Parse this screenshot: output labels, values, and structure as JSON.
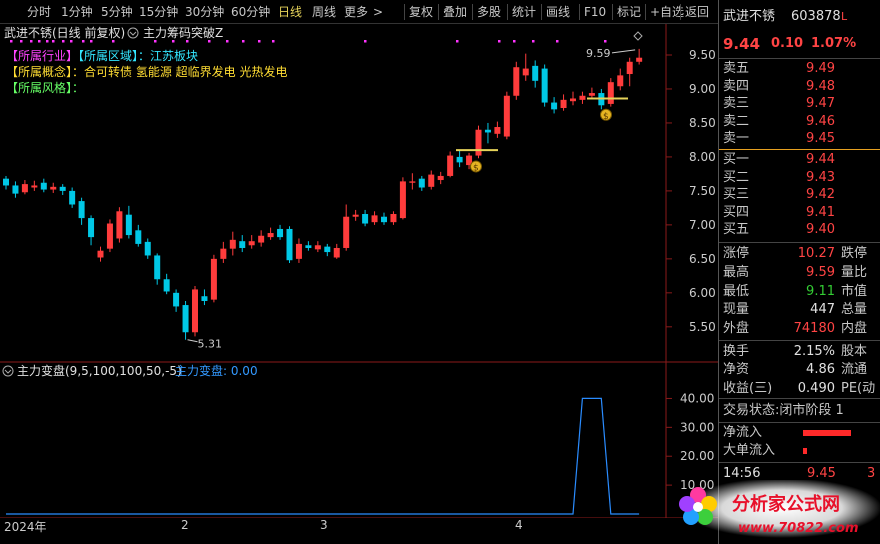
{
  "toolbar": {
    "items": [
      "分时",
      "1分钟",
      "5分钟",
      "15分钟",
      "30分钟",
      "60分钟",
      "日线",
      "周线",
      "更多"
    ],
    "active_index": 6,
    "tools": [
      "复权",
      "叠加",
      "多股",
      "统计",
      "画线",
      "F10",
      "标记",
      "+自选",
      "返回"
    ]
  },
  "main_chart": {
    "title": "武进不锈(日线 前复权)",
    "indicator_name": "主力筹码突破Z",
    "info_lines": [
      {
        "tag1": "【所属行业】",
        "tag2": "【所属区域】",
        "text": "：江苏板块"
      },
      {
        "tag1": "【所属概念】",
        "text": "：合可转债 氢能源 超临界发电 光热发电"
      },
      {
        "tag1": "【所属风格】",
        "text": "："
      }
    ],
    "price_axis": [
      "9.50",
      "9.00",
      "8.50",
      "8.00",
      "7.50",
      "7.00",
      "6.50",
      "6.00",
      "5.50"
    ],
    "high_label": "9.59",
    "low_label": "5.31",
    "coin_icon_label": "$"
  },
  "sub_chart": {
    "title": "主力变盘(9,5,100,100,50,-5)",
    "value_label": "主力变盘: 0.00",
    "axis": [
      "40.00",
      "30.00",
      "20.00",
      "10.00"
    ]
  },
  "date_axis": [
    "2024年",
    "2",
    "3",
    "4"
  ],
  "chart_data": [
    {
      "type": "candlestick",
      "title": "",
      "ylim": [
        5.1,
        9.75
      ],
      "candles": [
        {
          "o": 7.68,
          "c": 7.58,
          "h": 7.72,
          "l": 7.52,
          "up": false
        },
        {
          "o": 7.58,
          "c": 7.46,
          "h": 7.64,
          "l": 7.4,
          "up": false
        },
        {
          "o": 7.48,
          "c": 7.6,
          "h": 7.66,
          "l": 7.45,
          "up": true
        },
        {
          "o": 7.58,
          "c": 7.55,
          "h": 7.65,
          "l": 7.5,
          "up": true
        },
        {
          "o": 7.62,
          "c": 7.52,
          "h": 7.68,
          "l": 7.48,
          "up": false
        },
        {
          "o": 7.52,
          "c": 7.56,
          "h": 7.62,
          "l": 7.47,
          "up": true
        },
        {
          "o": 7.56,
          "c": 7.5,
          "h": 7.6,
          "l": 7.44,
          "up": false
        },
        {
          "o": 7.5,
          "c": 7.3,
          "h": 7.55,
          "l": 7.25,
          "up": false
        },
        {
          "o": 7.35,
          "c": 7.1,
          "h": 7.4,
          "l": 7.0,
          "up": false
        },
        {
          "o": 7.1,
          "c": 6.82,
          "h": 7.14,
          "l": 6.7,
          "up": false
        },
        {
          "o": 6.52,
          "c": 6.62,
          "h": 6.68,
          "l": 6.46,
          "up": true
        },
        {
          "o": 6.65,
          "c": 7.02,
          "h": 7.08,
          "l": 6.6,
          "up": true
        },
        {
          "o": 6.8,
          "c": 7.2,
          "h": 7.26,
          "l": 6.74,
          "up": true
        },
        {
          "o": 7.15,
          "c": 6.85,
          "h": 7.28,
          "l": 6.8,
          "up": false
        },
        {
          "o": 6.92,
          "c": 6.72,
          "h": 7.0,
          "l": 6.68,
          "up": false
        },
        {
          "o": 6.75,
          "c": 6.55,
          "h": 6.8,
          "l": 6.5,
          "up": false
        },
        {
          "o": 6.55,
          "c": 6.2,
          "h": 6.58,
          "l": 6.12,
          "up": false
        },
        {
          "o": 6.2,
          "c": 6.02,
          "h": 6.28,
          "l": 5.98,
          "up": false
        },
        {
          "o": 6.0,
          "c": 5.8,
          "h": 6.05,
          "l": 5.72,
          "up": false
        },
        {
          "o": 5.82,
          "c": 5.42,
          "h": 5.88,
          "l": 5.31,
          "up": false
        },
        {
          "o": 5.42,
          "c": 6.05,
          "h": 6.1,
          "l": 5.36,
          "up": true
        },
        {
          "o": 5.95,
          "c": 5.88,
          "h": 6.05,
          "l": 5.82,
          "up": false
        },
        {
          "o": 5.9,
          "c": 6.5,
          "h": 6.56,
          "l": 5.86,
          "up": true
        },
        {
          "o": 6.5,
          "c": 6.65,
          "h": 6.75,
          "l": 6.44,
          "up": true
        },
        {
          "o": 6.65,
          "c": 6.78,
          "h": 6.9,
          "l": 6.55,
          "up": true
        },
        {
          "o": 6.76,
          "c": 6.66,
          "h": 6.85,
          "l": 6.6,
          "up": false
        },
        {
          "o": 6.7,
          "c": 6.76,
          "h": 6.85,
          "l": 6.65,
          "up": true
        },
        {
          "o": 6.74,
          "c": 6.84,
          "h": 6.92,
          "l": 6.68,
          "up": true
        },
        {
          "o": 6.82,
          "c": 6.88,
          "h": 6.96,
          "l": 6.78,
          "up": true
        },
        {
          "o": 6.94,
          "c": 6.82,
          "h": 7.0,
          "l": 6.78,
          "up": false
        },
        {
          "o": 6.94,
          "c": 6.48,
          "h": 6.98,
          "l": 6.44,
          "up": false
        },
        {
          "o": 6.5,
          "c": 6.72,
          "h": 6.8,
          "l": 6.44,
          "up": true
        },
        {
          "o": 6.7,
          "c": 6.66,
          "h": 6.76,
          "l": 6.62,
          "up": false
        },
        {
          "o": 6.64,
          "c": 6.7,
          "h": 6.76,
          "l": 6.6,
          "up": true
        },
        {
          "o": 6.68,
          "c": 6.6,
          "h": 6.72,
          "l": 6.54,
          "up": false
        },
        {
          "o": 6.52,
          "c": 6.66,
          "h": 6.72,
          "l": 6.5,
          "up": true
        },
        {
          "o": 6.66,
          "c": 7.12,
          "h": 7.3,
          "l": 6.62,
          "up": true
        },
        {
          "o": 7.12,
          "c": 7.15,
          "h": 7.22,
          "l": 7.06,
          "up": true
        },
        {
          "o": 7.16,
          "c": 7.02,
          "h": 7.22,
          "l": 6.98,
          "up": false
        },
        {
          "o": 7.04,
          "c": 7.14,
          "h": 7.2,
          "l": 7.0,
          "up": true
        },
        {
          "o": 7.12,
          "c": 7.04,
          "h": 7.18,
          "l": 7.0,
          "up": false
        },
        {
          "o": 7.04,
          "c": 7.16,
          "h": 7.2,
          "l": 7.0,
          "up": true
        },
        {
          "o": 7.1,
          "c": 7.64,
          "h": 7.7,
          "l": 7.08,
          "up": true
        },
        {
          "o": 7.64,
          "c": 7.62,
          "h": 7.76,
          "l": 7.52,
          "up": true
        },
        {
          "o": 7.68,
          "c": 7.55,
          "h": 7.72,
          "l": 7.5,
          "up": false
        },
        {
          "o": 7.56,
          "c": 7.74,
          "h": 7.8,
          "l": 7.52,
          "up": true
        },
        {
          "o": 7.66,
          "c": 7.72,
          "h": 7.78,
          "l": 7.6,
          "up": true
        },
        {
          "o": 7.72,
          "c": 8.02,
          "h": 8.08,
          "l": 7.7,
          "up": true
        },
        {
          "o": 8.0,
          "c": 7.92,
          "h": 8.1,
          "l": 7.85,
          "up": false
        },
        {
          "o": 7.88,
          "c": 8.02,
          "h": 8.06,
          "l": 7.82,
          "up": true
        },
        {
          "o": 8.02,
          "c": 8.4,
          "h": 8.46,
          "l": 7.98,
          "up": true
        },
        {
          "o": 8.4,
          "c": 8.36,
          "h": 8.5,
          "l": 8.2,
          "up": false
        },
        {
          "o": 8.34,
          "c": 8.44,
          "h": 8.52,
          "l": 8.28,
          "up": true
        },
        {
          "o": 8.3,
          "c": 8.9,
          "h": 8.96,
          "l": 8.26,
          "up": true
        },
        {
          "o": 8.9,
          "c": 9.32,
          "h": 9.4,
          "l": 8.84,
          "up": true
        },
        {
          "o": 9.3,
          "c": 9.2,
          "h": 9.52,
          "l": 9.12,
          "up": true
        },
        {
          "o": 9.34,
          "c": 9.12,
          "h": 9.42,
          "l": 9.02,
          "up": false
        },
        {
          "o": 9.3,
          "c": 8.8,
          "h": 9.36,
          "l": 8.74,
          "up": false
        },
        {
          "o": 8.8,
          "c": 8.7,
          "h": 8.88,
          "l": 8.64,
          "up": false
        },
        {
          "o": 8.72,
          "c": 8.84,
          "h": 8.92,
          "l": 8.68,
          "up": true
        },
        {
          "o": 8.82,
          "c": 8.86,
          "h": 8.96,
          "l": 8.76,
          "up": true
        },
        {
          "o": 8.84,
          "c": 8.9,
          "h": 8.96,
          "l": 8.78,
          "up": true
        },
        {
          "o": 8.9,
          "c": 8.94,
          "h": 9.02,
          "l": 8.86,
          "up": true
        },
        {
          "o": 8.94,
          "c": 8.76,
          "h": 9.0,
          "l": 8.7,
          "up": false
        },
        {
          "o": 8.78,
          "c": 9.1,
          "h": 9.16,
          "l": 8.74,
          "up": true
        },
        {
          "o": 9.04,
          "c": 9.2,
          "h": 9.3,
          "l": 8.98,
          "up": true
        },
        {
          "o": 9.22,
          "c": 9.4,
          "h": 9.46,
          "l": 9.04,
          "up": true
        },
        {
          "o": 9.4,
          "c": 9.46,
          "h": 9.59,
          "l": 9.36,
          "up": true
        }
      ]
    },
    {
      "type": "line",
      "title": "",
      "ylim": [
        0,
        45
      ],
      "values": [
        0,
        0,
        0,
        0,
        0,
        0,
        0,
        0,
        0,
        0,
        0,
        0,
        0,
        0,
        0,
        0,
        0,
        0,
        0,
        0,
        0,
        0,
        0,
        0,
        0,
        0,
        0,
        0,
        0,
        0,
        0,
        0,
        0,
        0,
        0,
        0,
        0,
        0,
        0,
        0,
        0,
        0,
        0,
        0,
        0,
        0,
        0,
        0,
        0,
        0,
        0,
        0,
        0,
        0,
        0,
        0,
        0,
        0,
        0,
        0,
        0,
        40,
        40,
        40,
        0,
        0,
        0,
        0
      ]
    }
  ],
  "quote": {
    "name": "武进不锈",
    "code": "603878",
    "flag": "L",
    "price": "9.44",
    "change": "0.10",
    "pct": "1.07%",
    "sells": [
      {
        "label": "卖五",
        "price": "9.49"
      },
      {
        "label": "卖四",
        "price": "9.48"
      },
      {
        "label": "卖三",
        "price": "9.47"
      },
      {
        "label": "卖二",
        "price": "9.46"
      },
      {
        "label": "卖一",
        "price": "9.45"
      }
    ],
    "buys": [
      {
        "label": "买一",
        "price": "9.44"
      },
      {
        "label": "买二",
        "price": "9.43"
      },
      {
        "label": "买三",
        "price": "9.42"
      },
      {
        "label": "买四",
        "price": "9.41"
      },
      {
        "label": "买五",
        "price": "9.40"
      }
    ],
    "stats": [
      {
        "label": "涨停",
        "value": "10.27",
        "extra": "跌停",
        "color": "red"
      },
      {
        "label": "最高",
        "value": "9.59",
        "extra": "量比",
        "color": "red"
      },
      {
        "label": "最低",
        "value": "9.11",
        "extra": "市值",
        "color": "green"
      },
      {
        "label": "现量",
        "value": "447",
        "extra": "总量",
        "color": "white"
      },
      {
        "label": "外盘",
        "value": "74180",
        "extra": "内盘",
        "color": "red"
      }
    ],
    "stats2": [
      {
        "label": "换手",
        "value": "2.15%",
        "extra": "股本"
      },
      {
        "label": "净资",
        "value": "4.86",
        "extra": "流通"
      },
      {
        "label": "收益(三)",
        "value": "0.490",
        "extra": "PE(动"
      }
    ],
    "trade_state": "交易状态:闭市阶段 1",
    "net_inflow": "净流入",
    "big_inflow": "大单流入",
    "tick_time": "14:56",
    "tick_price": "9.45",
    "tick_extra": "3"
  },
  "watermark": {
    "cn": "分析家公式网",
    "url": "www.70822.com"
  },
  "colors": {
    "up": "#ff3c3c",
    "down": "#00c8e6",
    "price": "#ff4444",
    "accent": "#e6d35a"
  }
}
